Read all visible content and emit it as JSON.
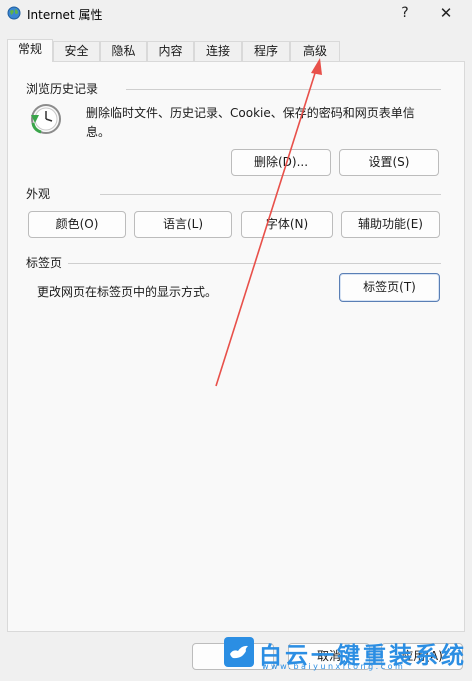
{
  "window": {
    "title": "Internet 属性",
    "help_label": "?",
    "close_label": "✕"
  },
  "tabs": [
    {
      "label": "常规",
      "active": true
    },
    {
      "label": "安全"
    },
    {
      "label": "隐私"
    },
    {
      "label": "内容"
    },
    {
      "label": "连接"
    },
    {
      "label": "程序"
    },
    {
      "label": "高级"
    }
  ],
  "history": {
    "title": "浏览历史记录",
    "description_line1": "删除临时文件、历史记录、Cookie、保存的密码和网页表单信",
    "description_line2": "息。",
    "delete_label": "删除(D)...",
    "settings_label": "设置(S)"
  },
  "appearance": {
    "title": "外观",
    "colors_label": "颜色(O)",
    "languages_label": "语言(L)",
    "fonts_label": "字体(N)",
    "accessibility_label": "辅助功能(E)"
  },
  "tabs_section": {
    "title": "标签页",
    "description": "更改网页在标签页中的显示方式。",
    "button_label": "标签页(T)"
  },
  "footer": {
    "cancel_label": "取消",
    "apply_label": "应用(A)"
  },
  "watermark": {
    "text": "白云一键重装系统",
    "url": "www.baiyunxitong.com"
  },
  "colors": {
    "annotation_arrow": "#e8504a",
    "watermark": "#2b8ee3",
    "accent_border": "#5a7fb5"
  }
}
